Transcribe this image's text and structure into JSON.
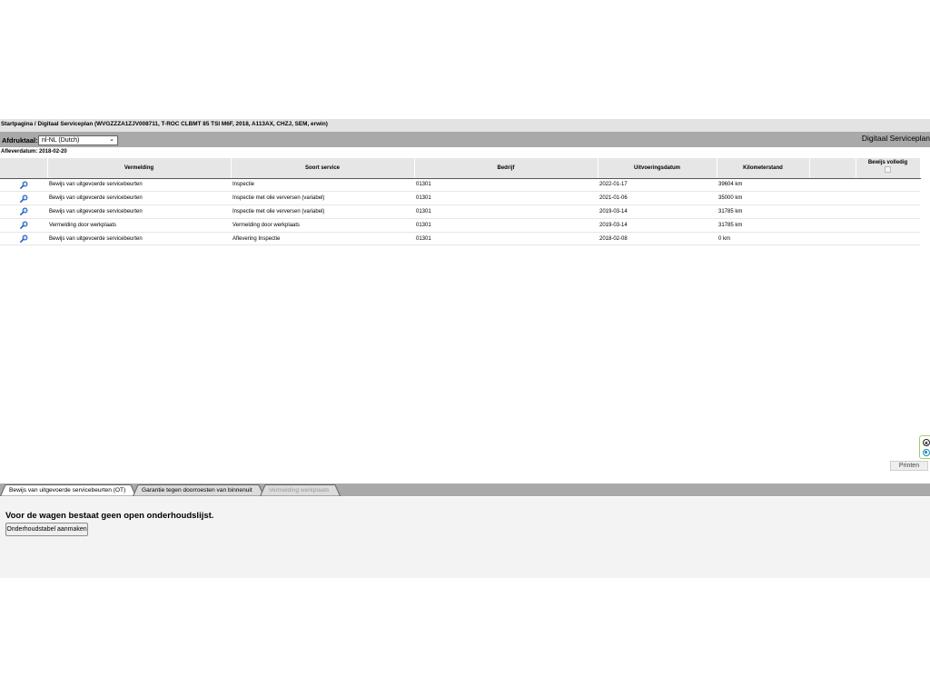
{
  "breadcrumb": "Startpagina / Digitaal Serviceplan (WVGZZZA1ZJV008711, T-ROC CLBMT 85 TSI M6F, 2018, A113AX, CHZJ, SEM, erwin)",
  "header": {
    "print_language_label": "Afdruktaal:",
    "print_language_value": "nl-NL (Dutch)",
    "app_title": "Digitaal Serviceplan"
  },
  "delivery_date": "Afleverdatum: 2018-02-20",
  "table": {
    "headers": {
      "entry": "Vermelding",
      "service_type": "Soort service",
      "company": "Bedrijf",
      "execution_date": "Uitvoeringsdatum",
      "mileage": "Kilometerstand",
      "proof_complete": "Bewijs volledig"
    },
    "rows": [
      {
        "entry": "Bewijs van uitgevoerde servicebeurten",
        "service_type": "Inspectie",
        "company": "01301",
        "execution_date": "2022-01-17",
        "mileage": "39604 km"
      },
      {
        "entry": "Bewijs van uitgevoerde servicebeurten",
        "service_type": "Inspectie met olie verversen (variabel)",
        "company": "01301",
        "execution_date": "2021-01-06",
        "mileage": "35000 km"
      },
      {
        "entry": "Bewijs van uitgevoerde servicebeurten",
        "service_type": "Inspectie met olie verversen (variabel)",
        "company": "01301",
        "execution_date": "2019-03-14",
        "mileage": "31785 km"
      },
      {
        "entry": "Vermelding door werkplaats",
        "service_type": "Vermelding door werkplaats",
        "company": "01301",
        "execution_date": "2019-03-14",
        "mileage": "31785 km"
      },
      {
        "entry": "Bewijs van uitgevoerde servicebeurten",
        "service_type": "Aflevering Inspectie",
        "company": "01301",
        "execution_date": "2018-02-08",
        "mileage": "0 km"
      }
    ]
  },
  "print_button": "Printen",
  "tabs": [
    {
      "label": "Bewijs van uitgevoerde servicebeurten (OT)"
    },
    {
      "label": "Garantie tegen doorroesten van binnenuit"
    },
    {
      "label": "Vermelding werkplaats"
    }
  ],
  "bottom_panel": {
    "message": "Voor de wagen bestaat geen open onderhoudslijst.",
    "create_button": "Onderhoudstabel aanmaken"
  },
  "icons": {
    "detail_icon": "magnifier-icon",
    "side_tools": [
      "close-icon",
      "settings-icon"
    ]
  },
  "colors": {
    "header_bar": "#a9a9a9",
    "breadcrumb_bar": "#e3e3e3",
    "table_header": "#e6e6e6",
    "bottom_panel": "#f3f3f3",
    "magnifier_blue": "#1f5fbf",
    "side_tools_border": "#9fd06a"
  }
}
